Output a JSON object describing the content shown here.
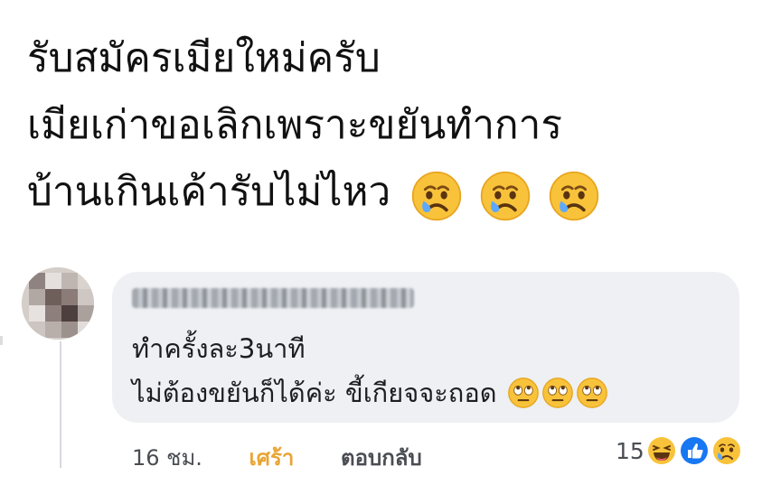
{
  "post": {
    "line1": "รับสมัครเมียใหม่ครับ",
    "line2": "เมียเก่าขอเลิกเพราะขยันทำการ",
    "line3": "บ้านเกินเค้ารับไม่ไหว",
    "emojis": [
      "crying-face-icon",
      "crying-face-icon",
      "crying-face-icon"
    ]
  },
  "comment": {
    "author_name": "",
    "line1": "ทำครั้งละ3นาที",
    "line2": "ไม่ต้องขยันก็ได้ค่ะ ขี้เกียจจะถอด",
    "emojis": [
      "eye-roll-face-icon",
      "eye-roll-face-icon",
      "eye-roll-face-icon"
    ],
    "time": "16 ชม.",
    "reaction_label": "เศร้า",
    "reply_label": "ตอบกลับ",
    "reaction_count": "15",
    "reaction_icons": [
      "haha-reaction-icon",
      "like-reaction-icon",
      "sad-reaction-icon"
    ]
  },
  "colors": {
    "bubble": "#eef0f3",
    "sad_reaction_label": "#e8a534",
    "like_blue": "#1877f2",
    "emoji_yellow": "#f8c33a"
  }
}
